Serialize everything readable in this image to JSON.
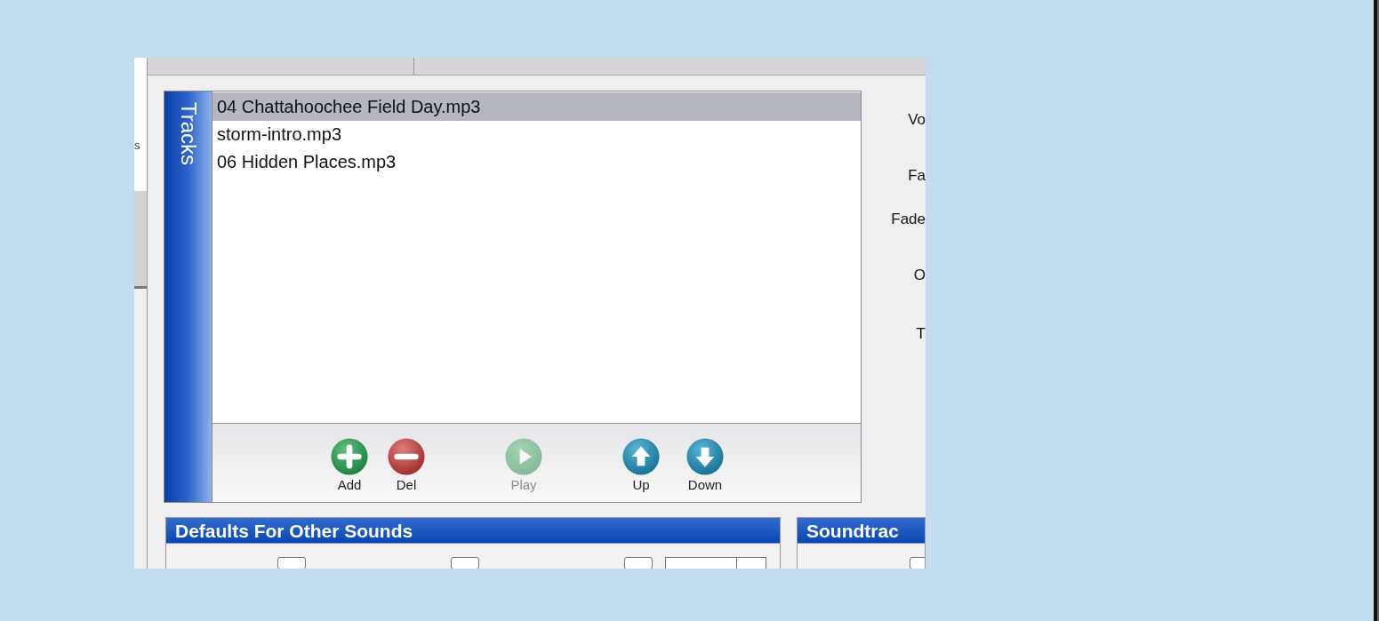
{
  "left_strip": {
    "text": "s"
  },
  "tracks": {
    "title": "Tracks",
    "items": [
      {
        "name": "04 Chattahoochee Field Day.mp3",
        "selected": true
      },
      {
        "name": "storm-intro.mp3",
        "selected": false
      },
      {
        "name": "06 Hidden Places.mp3",
        "selected": false
      }
    ],
    "buttons": [
      {
        "kind": "add",
        "label": "Add",
        "disabled": false
      },
      {
        "kind": "del",
        "label": "Del",
        "disabled": false
      },
      {
        "kind": "play",
        "label": "Play",
        "disabled": true
      },
      {
        "kind": "up",
        "label": "Up",
        "disabled": false
      },
      {
        "kind": "down",
        "label": "Down",
        "disabled": false
      }
    ]
  },
  "settings_labels": [
    "Vo",
    "Fa",
    "Fade",
    "O",
    "T"
  ],
  "defaults_panel": {
    "title": "Defaults For Other Sounds"
  },
  "soundtrack_panel": {
    "title": "Soundtrac"
  }
}
